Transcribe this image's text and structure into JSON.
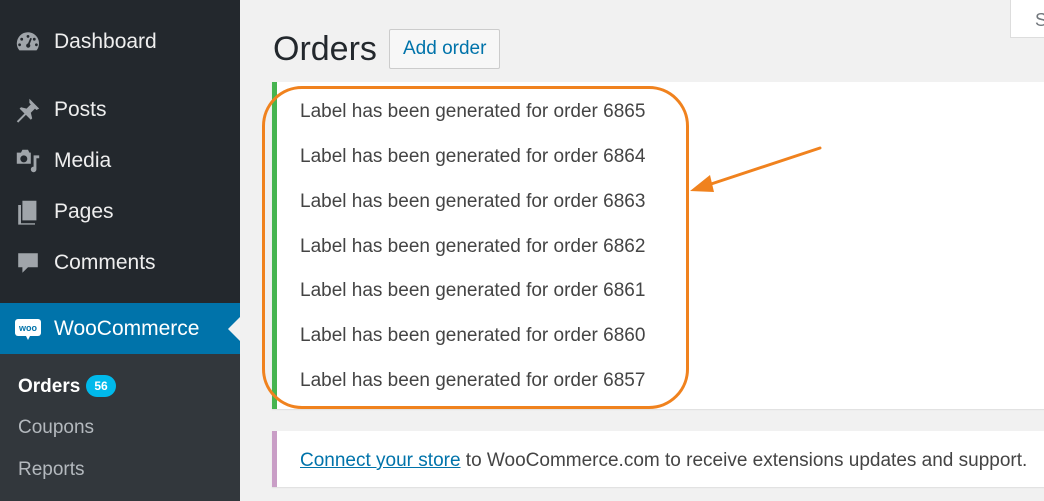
{
  "sidebar": {
    "items": [
      {
        "label": "Dashboard",
        "icon": "dashboard-icon"
      },
      {
        "label": "Posts",
        "icon": "pin-icon"
      },
      {
        "label": "Media",
        "icon": "media-icon"
      },
      {
        "label": "Pages",
        "icon": "pages-icon"
      },
      {
        "label": "Comments",
        "icon": "comment-icon"
      },
      {
        "label": "WooCommerce",
        "icon": "woo-icon"
      }
    ],
    "submenu": [
      {
        "label": "Orders",
        "count": "56"
      },
      {
        "label": "Coupons"
      },
      {
        "label": "Reports"
      }
    ]
  },
  "header": {
    "title": "Orders",
    "add_button": "Add order",
    "screen_options": "S"
  },
  "notices": {
    "messages": [
      "Label has been generated for order 6865",
      "Label has been generated for order 6864",
      "Label has been generated for order 6863",
      "Label has been generated for order 6862",
      "Label has been generated for order 6861",
      "Label has been generated for order 6860",
      "Label has been generated for order 6857"
    ],
    "connect_link": "Connect your store",
    "connect_text": " to WooCommerce.com to receive extensions updates and support."
  },
  "colors": {
    "sidebar_bg": "#23282d",
    "active_menu": "#0073aa",
    "success_border": "#46b450",
    "highlight": "#f0821e",
    "count_badge": "#00b9eb"
  }
}
